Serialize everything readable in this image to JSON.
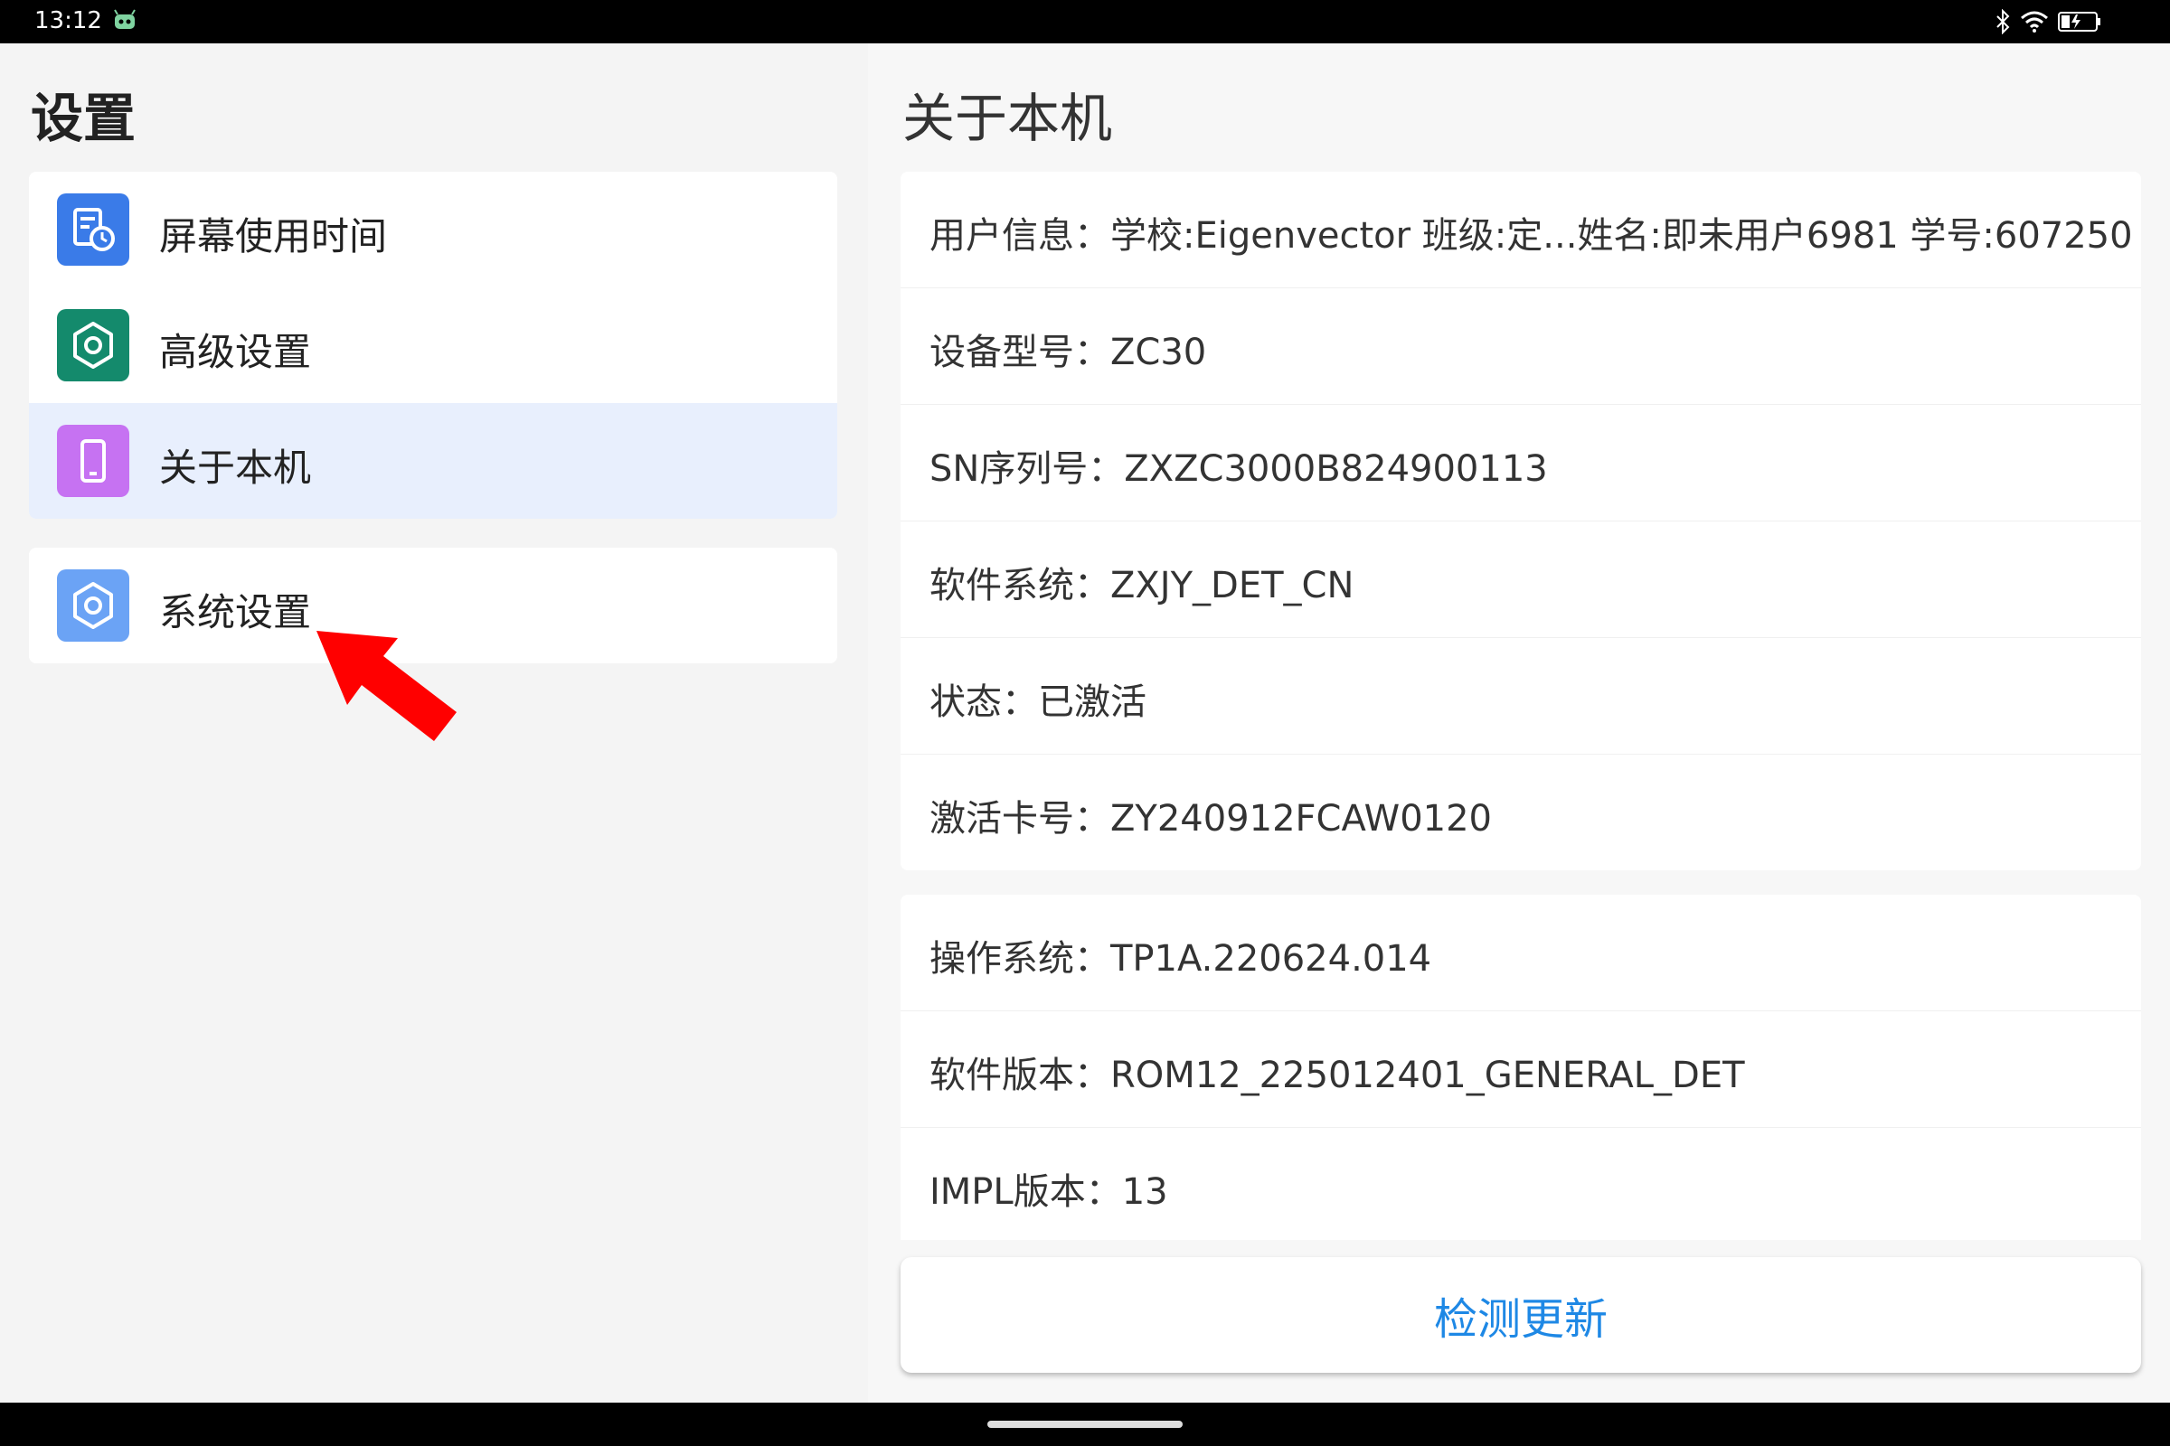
{
  "status_bar": {
    "time": "13:12"
  },
  "left": {
    "title": "设置",
    "menu": [
      {
        "label": "屏幕使用时间",
        "icon": "screen-time-icon",
        "color": "#3a7be8"
      },
      {
        "label": "高级设置",
        "icon": "advanced-settings-gear-icon",
        "color": "#148a6c"
      },
      {
        "label": "关于本机",
        "icon": "phone-device-icon",
        "color": "#c672f2"
      },
      {
        "label": "系统设置",
        "icon": "system-settings-gear-icon",
        "color": "#6ba3f5"
      }
    ]
  },
  "right": {
    "title": "关于本机",
    "group1": [
      "用户信息：学校:Eigenvector 班级:定...姓名:即未用户6981 学号:607250",
      "设备型号：ZC30",
      "SN序列号：ZXZC3000B824900113",
      "软件系统：ZXJY_DET_CN",
      "状态：已激活",
      "激活卡号：ZY240912FCAW0120"
    ],
    "group2": [
      "操作系统：TP1A.220624.014",
      "软件版本：ROM12_225012401_GENERAL_DET",
      "IMPL版本：13"
    ],
    "update_button": "检测更新"
  },
  "colors": {
    "accent": "#1e88e5",
    "selected_bg": "#e8effd",
    "arrow": "#ff0000"
  }
}
